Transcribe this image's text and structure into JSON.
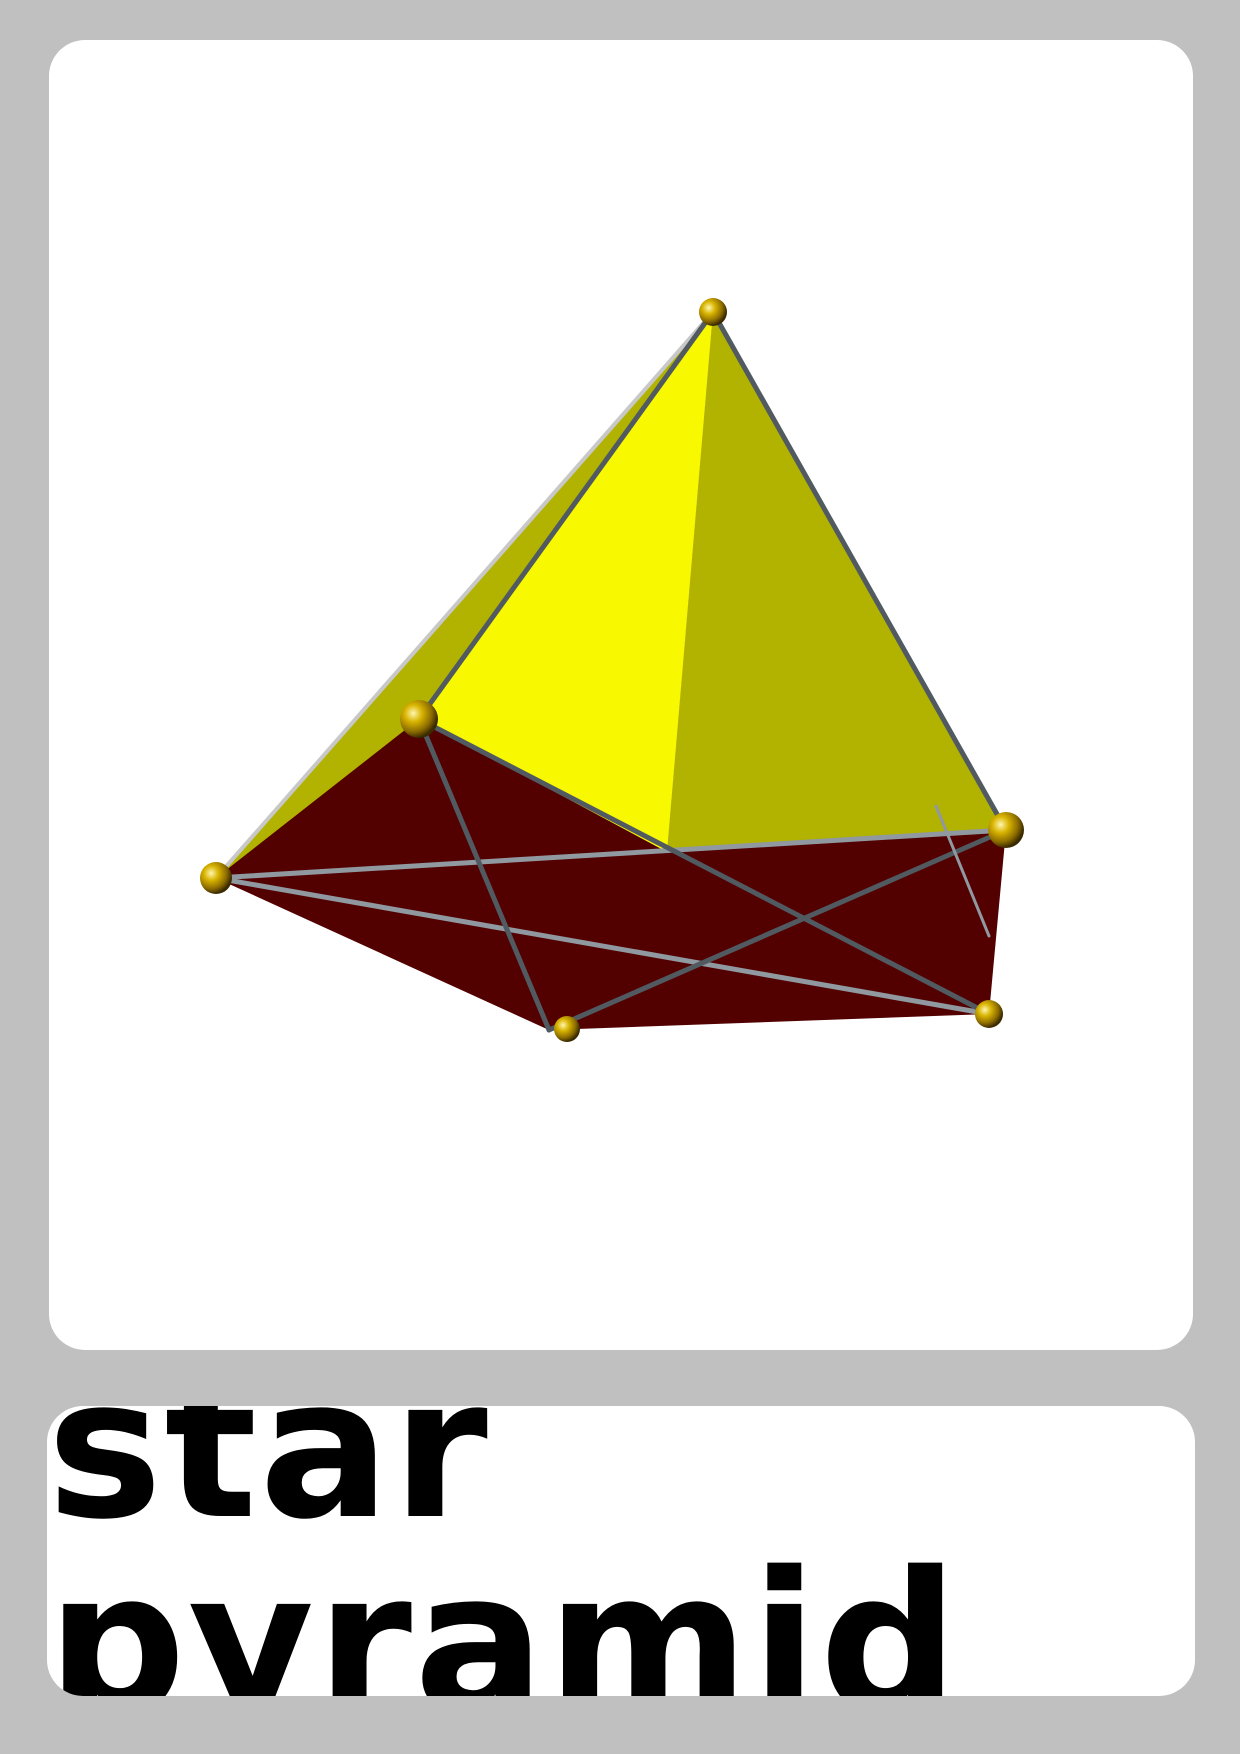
{
  "card": {
    "label": "star pyramid"
  },
  "illustration": {
    "subject": "star-pyramid-polyhedron",
    "colors": {
      "background": "#c0c0c0",
      "card": "#ffffff",
      "face_light": "#f8f800",
      "face_dark": "#b2b200",
      "base_face": "#520000",
      "edge": "#505a60",
      "vertex": "#c8a400"
    }
  }
}
